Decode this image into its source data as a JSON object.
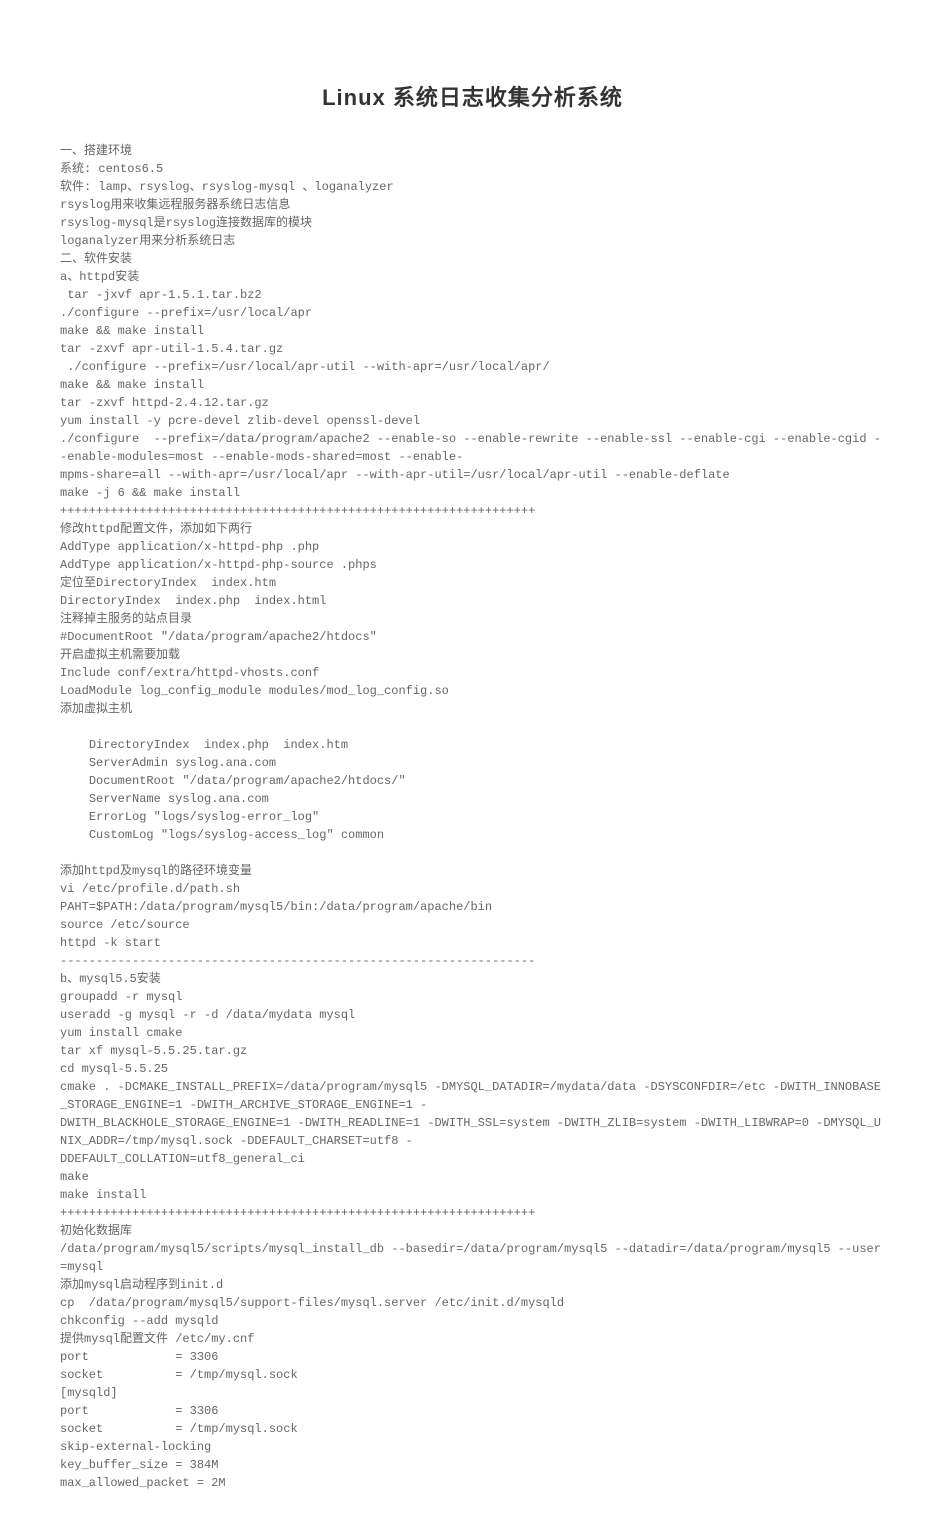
{
  "title": "Linux 系统日志收集分析系统",
  "lines": [
    "一、搭建环境",
    "系统: centos6.5",
    "软件: lamp、rsyslog、rsyslog-mysql 、loganalyzer",
    "rsyslog用来收集远程服务器系统日志信息",
    "rsyslog-mysql是rsyslog连接数据库的模块",
    "loganalyzer用来分析系统日志",
    "二、软件安装",
    "a、httpd安装",
    " tar -jxvf apr-1.5.1.tar.bz2",
    "./configure --prefix=/usr/local/apr",
    "make && make install",
    "tar -zxvf apr-util-1.5.4.tar.gz",
    " ./configure --prefix=/usr/local/apr-util --with-apr=/usr/local/apr/",
    "make && make install",
    "tar -zxvf httpd-2.4.12.tar.gz",
    "yum install -y pcre-devel zlib-devel openssl-devel",
    "./configure  --prefix=/data/program/apache2 --enable-so --enable-rewrite --enable-ssl --enable-cgi --enable-cgid --enable-modules=most --enable-mods-shared=most --enable-",
    "mpms-share=all --with-apr=/usr/local/apr --with-apr-util=/usr/local/apr-util --enable-deflate",
    "make -j 6 && make install",
    "++++++++++++++++++++++++++++++++++++++++++++++++++++++++++++++++++",
    "修改httpd配置文件，添加如下两行",
    "AddType application/x-httpd-php .php",
    "AddType application/x-httpd-php-source .phps",
    "定位至DirectoryIndex  index.htm",
    "DirectoryIndex  index.php  index.html",
    "注释掉主服务的站点目录",
    "#DocumentRoot \"/data/program/apache2/htdocs\"",
    "开启虚拟主机需要加载",
    "Include conf/extra/httpd-vhosts.conf",
    "LoadModule log_config_module modules/mod_log_config.so",
    "添加虚拟主机",
    "",
    "    DirectoryIndex  index.php  index.htm",
    "    ServerAdmin syslog.ana.com",
    "    DocumentRoot \"/data/program/apache2/htdocs/\"",
    "    ServerName syslog.ana.com",
    "    ErrorLog \"logs/syslog-error_log\"",
    "    CustomLog \"logs/syslog-access_log\" common",
    "",
    "添加httpd及mysql的路径环境变量",
    "vi /etc/profile.d/path.sh",
    "PAHT=$PATH:/data/program/mysql5/bin:/data/program/apache/bin",
    "source /etc/source",
    "httpd -k start",
    "------------------------------------------------------------------",
    "b、mysql5.5安装",
    "groupadd -r mysql",
    "useradd -g mysql -r -d /data/mydata mysql",
    "yum install cmake",
    "tar xf mysql-5.5.25.tar.gz",
    "cd mysql-5.5.25",
    "cmake . -DCMAKE_INSTALL_PREFIX=/data/program/mysql5 -DMYSQL_DATADIR=/mydata/data -DSYSCONFDIR=/etc -DWITH_INNOBASE_STORAGE_ENGINE=1 -DWITH_ARCHIVE_STORAGE_ENGINE=1 -",
    "DWITH_BLACKHOLE_STORAGE_ENGINE=1 -DWITH_READLINE=1 -DWITH_SSL=system -DWITH_ZLIB=system -DWITH_LIBWRAP=0 -DMYSQL_UNIX_ADDR=/tmp/mysql.sock -DDEFAULT_CHARSET=utf8 -",
    "DDEFAULT_COLLATION=utf8_general_ci",
    "make",
    "make install",
    "++++++++++++++++++++++++++++++++++++++++++++++++++++++++++++++++++",
    "初始化数据库",
    "/data/program/mysql5/scripts/mysql_install_db --basedir=/data/program/mysql5 --datadir=/data/program/mysql5 --user=mysql",
    "添加mysql启动程序到init.d",
    "cp  /data/program/mysql5/support-files/mysql.server /etc/init.d/mysqld",
    "chkconfig --add mysqld",
    "提供mysql配置文件 /etc/my.cnf",
    "port            = 3306",
    "socket          = /tmp/mysql.sock",
    "[mysqld]",
    "port            = 3306",
    "socket          = /tmp/mysql.sock",
    "skip-external-locking",
    "key_buffer_size = 384M",
    "max_allowed_packet = 2M"
  ]
}
